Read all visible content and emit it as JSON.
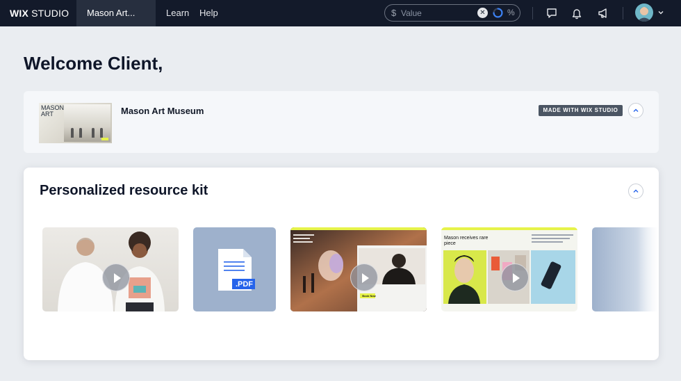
{
  "topbar": {
    "logo_main": "WIX",
    "logo_sub": "STUDIO",
    "site_tab": "Mason Art...",
    "nav": [
      "Learn",
      "Help"
    ],
    "search": {
      "prefix": "$",
      "placeholder": "Value",
      "suffix": "%"
    },
    "icons": [
      "chat-icon",
      "bell-icon",
      "megaphone-icon"
    ]
  },
  "welcome": "Welcome Client,",
  "site_card": {
    "name": "Mason Art Museum",
    "thumb_title_1": "MASON",
    "thumb_title_2": "ART",
    "badge": "MADE WITH WIX STUDIO"
  },
  "kit": {
    "title": "Personalized resource kit",
    "tiles": [
      {
        "type": "video"
      },
      {
        "type": "pdf",
        "label": ".PDF"
      },
      {
        "type": "video",
        "caption": "Book Now"
      },
      {
        "type": "video",
        "caption": "Mason receives rare piece"
      },
      {
        "type": "more"
      }
    ]
  },
  "colors": {
    "topbar": "#131a2a",
    "background": "#eaedf1",
    "accent_blue": "#2563eb",
    "lime": "#e6f34a"
  }
}
